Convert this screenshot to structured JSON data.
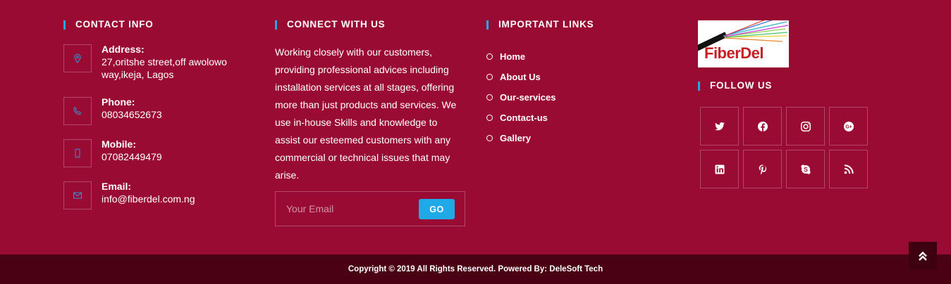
{
  "contact": {
    "heading": "CONTACT INFO",
    "items": [
      {
        "icon": "map-pin-icon",
        "title": "Address:",
        "lines": [
          "27,oritshe street,off awolowo",
          "way,ikeja, Lagos"
        ]
      },
      {
        "icon": "phone-icon",
        "title": "Phone:",
        "lines": [
          "08034652673"
        ]
      },
      {
        "icon": "mobile-icon",
        "title": "Mobile:",
        "lines": [
          "07082449479"
        ]
      },
      {
        "icon": "envelope-icon",
        "title": "Email:",
        "lines": [
          "info@fiberdel.com.ng"
        ]
      }
    ]
  },
  "connect": {
    "heading": "CONNECT WITH US",
    "text": "Working closely with our customers, providing professional advices including installation services at all stages, offering more than just products and services. We use in-house Skills and knowledge to assist our esteemed customers with any commercial or technical issues that may arise.",
    "email_placeholder": "Your Email",
    "go_label": "GO"
  },
  "links": {
    "heading": "IMPORTANT LINKS",
    "items": [
      "Home",
      "About Us",
      "Our-services",
      "Contact-us",
      "Gallery"
    ]
  },
  "follow": {
    "logo_text": "FiberDel",
    "heading": "FOLLOW US",
    "social": [
      "twitter-icon",
      "facebook-icon",
      "instagram-icon",
      "google-plus-icon",
      "linkedin-icon",
      "pinterest-icon",
      "skype-icon",
      "rss-icon"
    ]
  },
  "footer": {
    "copyright": "Copyright © 2019 All Rights Reserved. Powered By: DeleSoft Tech"
  },
  "colors": {
    "background": "#9a0b33",
    "bottom_bar": "#4a0114",
    "accent": "#1fa9e6",
    "icon_blue": "#3d87c8"
  }
}
